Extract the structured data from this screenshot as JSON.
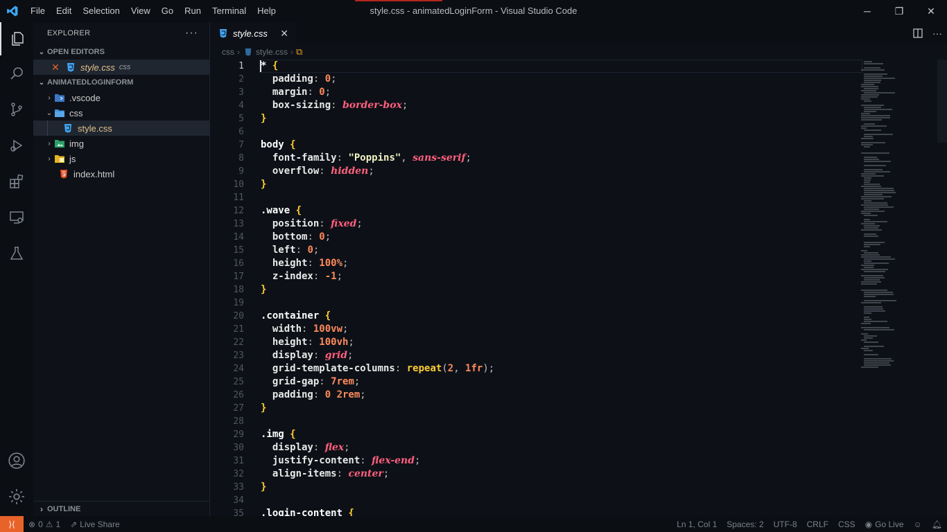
{
  "window": {
    "title": "style.css - animatedLoginForm - Visual Studio Code",
    "menu": [
      "File",
      "Edit",
      "Selection",
      "View",
      "Go",
      "Run",
      "Terminal",
      "Help"
    ],
    "controls": {
      "minimize": "─",
      "restore": "❐",
      "close": "✕"
    }
  },
  "activity": {
    "items": [
      "explorer-icon",
      "search-icon",
      "source-control-icon",
      "run-debug-icon",
      "extensions-icon",
      "remote-explorer-icon",
      "testing-icon"
    ],
    "bottom": [
      "account-icon",
      "manage-gear-icon"
    ]
  },
  "sidebar": {
    "title": "EXPLORER",
    "more": "···",
    "open_editors_label": "OPEN EDITORS",
    "open_editor": {
      "name": "style.css",
      "folder": "css"
    },
    "project_label": "ANIMATEDLOGINFORM",
    "tree": [
      {
        "name": ".vscode",
        "type": "folder",
        "expanded": false
      },
      {
        "name": "css",
        "type": "folder",
        "expanded": true
      },
      {
        "name": "style.css",
        "type": "css-file"
      },
      {
        "name": "img",
        "type": "folder",
        "expanded": false
      },
      {
        "name": "js",
        "type": "folder",
        "expanded": false
      },
      {
        "name": "index.html",
        "type": "html-file"
      }
    ],
    "outline_label": "OUTLINE"
  },
  "editor": {
    "tab": {
      "label": "style.css",
      "close": "✕"
    },
    "breadcrumbs": [
      "css",
      "style.css"
    ],
    "active_line": 1,
    "lines": [
      [
        [
          "*",
          "sel"
        ],
        [
          " ",
          "p"
        ],
        [
          "{",
          "brace"
        ]
      ],
      [
        [
          "  padding",
          "prop"
        ],
        [
          ": ",
          "punc"
        ],
        [
          "0",
          "num"
        ],
        [
          ";",
          "punc"
        ]
      ],
      [
        [
          "  margin",
          "prop"
        ],
        [
          ": ",
          "punc"
        ],
        [
          "0",
          "num"
        ],
        [
          ";",
          "punc"
        ]
      ],
      [
        [
          "  box-sizing",
          "prop"
        ],
        [
          ": ",
          "punc"
        ],
        [
          "border-box",
          "kw"
        ],
        [
          ";",
          "punc"
        ]
      ],
      [
        [
          "}",
          "brace"
        ]
      ],
      [],
      [
        [
          "body ",
          "sel"
        ],
        [
          "{",
          "brace"
        ]
      ],
      [
        [
          "  font-family",
          "prop"
        ],
        [
          ": ",
          "punc"
        ],
        [
          "\"Poppins\"",
          "str"
        ],
        [
          ", ",
          "punc"
        ],
        [
          "sans-serif",
          "kw"
        ],
        [
          ";",
          "punc"
        ]
      ],
      [
        [
          "  overflow",
          "prop"
        ],
        [
          ": ",
          "punc"
        ],
        [
          "hidden",
          "kw"
        ],
        [
          ";",
          "punc"
        ]
      ],
      [
        [
          "}",
          "brace"
        ]
      ],
      [],
      [
        [
          ".wave ",
          "sel"
        ],
        [
          "{",
          "brace"
        ]
      ],
      [
        [
          "  position",
          "prop"
        ],
        [
          ": ",
          "punc"
        ],
        [
          "fixed",
          "kw"
        ],
        [
          ";",
          "punc"
        ]
      ],
      [
        [
          "  bottom",
          "prop"
        ],
        [
          ": ",
          "punc"
        ],
        [
          "0",
          "num"
        ],
        [
          ";",
          "punc"
        ]
      ],
      [
        [
          "  left",
          "prop"
        ],
        [
          ": ",
          "punc"
        ],
        [
          "0",
          "num"
        ],
        [
          ";",
          "punc"
        ]
      ],
      [
        [
          "  height",
          "prop"
        ],
        [
          ": ",
          "punc"
        ],
        [
          "100%",
          "num"
        ],
        [
          ";",
          "punc"
        ]
      ],
      [
        [
          "  z-index",
          "prop"
        ],
        [
          ": ",
          "punc"
        ],
        [
          "-1",
          "num"
        ],
        [
          ";",
          "punc"
        ]
      ],
      [
        [
          "}",
          "brace"
        ]
      ],
      [],
      [
        [
          ".container ",
          "sel"
        ],
        [
          "{",
          "brace"
        ]
      ],
      [
        [
          "  width",
          "prop"
        ],
        [
          ": ",
          "punc"
        ],
        [
          "100vw",
          "num"
        ],
        [
          ";",
          "punc"
        ]
      ],
      [
        [
          "  height",
          "prop"
        ],
        [
          ": ",
          "punc"
        ],
        [
          "100vh",
          "num"
        ],
        [
          ";",
          "punc"
        ]
      ],
      [
        [
          "  display",
          "prop"
        ],
        [
          ": ",
          "punc"
        ],
        [
          "grid",
          "kw"
        ],
        [
          ";",
          "punc"
        ]
      ],
      [
        [
          "  grid-template-columns",
          "prop"
        ],
        [
          ": ",
          "punc"
        ],
        [
          "repeat",
          "fn"
        ],
        [
          "(",
          "punc"
        ],
        [
          "2",
          "num"
        ],
        [
          ", ",
          "punc"
        ],
        [
          "1fr",
          "num"
        ],
        [
          ");",
          "punc"
        ]
      ],
      [
        [
          "  grid-gap",
          "prop"
        ],
        [
          ": ",
          "punc"
        ],
        [
          "7rem",
          "num"
        ],
        [
          ";",
          "punc"
        ]
      ],
      [
        [
          "  padding",
          "prop"
        ],
        [
          ": ",
          "punc"
        ],
        [
          "0 2rem",
          "num"
        ],
        [
          ";",
          "punc"
        ]
      ],
      [
        [
          "}",
          "brace"
        ]
      ],
      [],
      [
        [
          ".img ",
          "sel"
        ],
        [
          "{",
          "brace"
        ]
      ],
      [
        [
          "  display",
          "prop"
        ],
        [
          ": ",
          "punc"
        ],
        [
          "flex",
          "kw"
        ],
        [
          ";",
          "punc"
        ]
      ],
      [
        [
          "  justify-content",
          "prop"
        ],
        [
          ": ",
          "punc"
        ],
        [
          "flex-end",
          "kw"
        ],
        [
          ";",
          "punc"
        ]
      ],
      [
        [
          "  align-items",
          "prop"
        ],
        [
          ": ",
          "punc"
        ],
        [
          "center",
          "kw"
        ],
        [
          ";",
          "punc"
        ]
      ],
      [
        [
          "}",
          "brace"
        ]
      ],
      [],
      [
        [
          ".login-content ",
          "sel"
        ],
        [
          "{",
          "brace"
        ]
      ]
    ]
  },
  "statusbar": {
    "remote": "⟩⟨",
    "errors": "0",
    "warnings": "1",
    "live_share": "Live Share",
    "position": "Ln 1, Col 1",
    "spaces": "Spaces: 2",
    "encoding": "UTF-8",
    "eol": "CRLF",
    "language": "CSS",
    "go_live": "Go Live"
  },
  "colors": {
    "accent": "#e8632a",
    "title_accent": "#b3261e",
    "background": "#0d1117"
  }
}
